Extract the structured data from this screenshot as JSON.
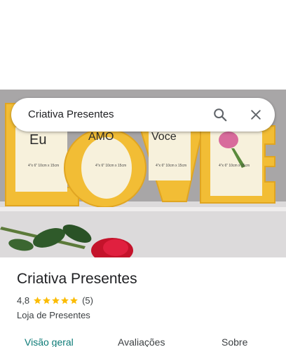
{
  "search": {
    "query": "Criativa Presentes"
  },
  "photo": {
    "frame_words": [
      "Eu",
      "AMO",
      "Voce"
    ],
    "frame_size_labels": [
      "4\"x 6\"\n10cm x 15cm",
      "4\"x 6\"\n10cm x 15cm",
      "4\"x 6\"\n10cm x 15cm",
      "4\"x 6\"\n10cm x 15cm"
    ]
  },
  "place": {
    "name": "Criativa Presentes",
    "rating": "4,8",
    "stars_filled": 5,
    "reviews": "(5)",
    "category": "Loja de Presentes"
  },
  "tabs": [
    {
      "label": "Visão geral"
    },
    {
      "label": "Avaliações"
    },
    {
      "label": "Sobre"
    }
  ],
  "colors": {
    "accent": "#0b7a76",
    "star": "#fbbc04",
    "frame_yellow": "#f2bd35"
  }
}
